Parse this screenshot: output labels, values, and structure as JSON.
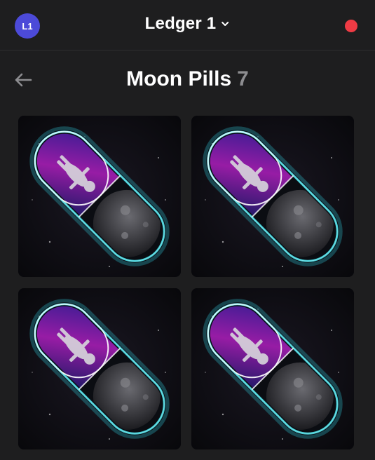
{
  "header": {
    "avatar_initials": "L1",
    "wallet_name": "Ledger 1",
    "status_color": "#ef3b44",
    "avatar_color": "#4c4ad8"
  },
  "collection": {
    "name": "Moon Pills",
    "count": "7"
  },
  "nfts": [
    {
      "id": "nft-1",
      "icon": "moon-pill-image"
    },
    {
      "id": "nft-2",
      "icon": "moon-pill-image"
    },
    {
      "id": "nft-3",
      "icon": "moon-pill-image"
    },
    {
      "id": "nft-4",
      "icon": "moon-pill-image"
    }
  ]
}
